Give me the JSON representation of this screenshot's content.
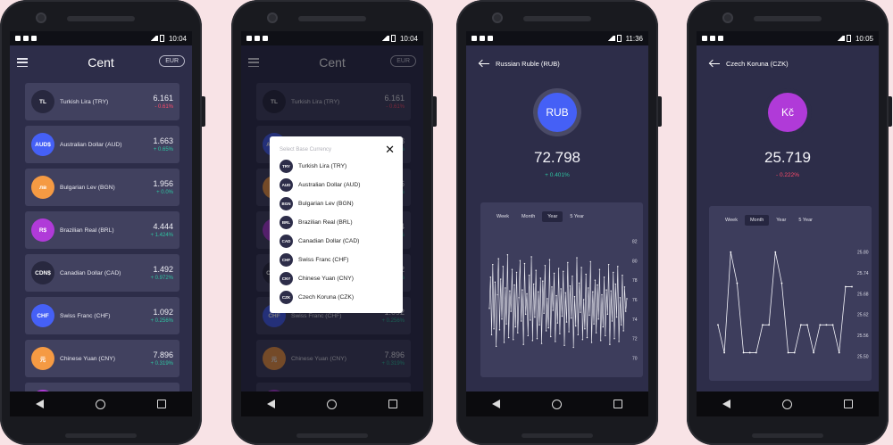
{
  "statusbar_times": [
    "10:04",
    "10:04",
    "11:36",
    "10:05"
  ],
  "list_screen": {
    "title": "Cent",
    "base_currency": "EUR",
    "rows": [
      {
        "code": "TL",
        "name": "Turkish Lira (TRY)",
        "value": "6.161",
        "change": "- 0.61%",
        "dir": "down",
        "color": "#28283f"
      },
      {
        "code": "AUD$",
        "name": "Australian Dollar (AUD)",
        "value": "1.663",
        "change": "+ 0.65%",
        "dir": "up",
        "color": "#4560f6"
      },
      {
        "code": "лв",
        "name": "Bulgarian Lev (BGN)",
        "value": "1.956",
        "change": "+ 0.0%",
        "dir": "up",
        "color": "#f59a43"
      },
      {
        "code": "R$",
        "name": "Brazilian Real (BRL)",
        "value": "4.444",
        "change": "+ 1.424%",
        "dir": "up",
        "color": "#b03ad8"
      },
      {
        "code": "CDN$",
        "name": "Canadian Dollar (CAD)",
        "value": "1.492",
        "change": "+ 0.972%",
        "dir": "up",
        "color": "#28283f"
      },
      {
        "code": "CHF",
        "name": "Swiss Franc (CHF)",
        "value": "1.092",
        "change": "+ 0.256%",
        "dir": "up",
        "color": "#4560f6"
      },
      {
        "code": "元",
        "name": "Chinese Yuan (CNY)",
        "value": "7.896",
        "change": "+ 0.319%",
        "dir": "up",
        "color": "#f59a43"
      }
    ]
  },
  "dialog": {
    "title": "Select Base Currency",
    "close_glyph": "✕",
    "options": [
      {
        "code": "TRY",
        "name": "Turkish Lira (TRY)"
      },
      {
        "code": "AUD",
        "name": "Australian Dollar (AUD)"
      },
      {
        "code": "BGN",
        "name": "Bulgarian Lev (BGN)"
      },
      {
        "code": "BRL",
        "name": "Brazilian Real (BRL)"
      },
      {
        "code": "CAD",
        "name": "Canadian Dollar (CAD)"
      },
      {
        "code": "CHF",
        "name": "Swiss Franc (CHF)"
      },
      {
        "code": "CNY",
        "name": "Chinese Yuan (CNY)"
      },
      {
        "code": "CZK",
        "name": "Czech Koruna (CZK)"
      }
    ]
  },
  "rub_screen": {
    "title": "Russian Ruble (RUB)",
    "badge": "RUB",
    "badge_color": "#4560f6",
    "value": "72.798",
    "change": "+ 0.401%",
    "tabs": [
      "Week",
      "Month",
      "Year",
      "5 Year"
    ],
    "active_tab": "Year"
  },
  "czk_screen": {
    "title": "Czech Koruna (CZK)",
    "badge": "Kč",
    "badge_color": "#b03ad8",
    "value": "25.719",
    "change": "- 0.222%",
    "tabs": [
      "Week",
      "Month",
      "Year",
      "5 Year"
    ],
    "active_tab": "Month"
  },
  "chart_data": [
    {
      "type": "line",
      "title": "",
      "yticks": [
        "82",
        "80",
        "78",
        "76",
        "74",
        "72",
        "70"
      ],
      "ylim": [
        69.5,
        82.5
      ],
      "grid": false,
      "series": [
        {
          "values": [
            75.1,
            78.3,
            72.4,
            79.6,
            73.0,
            77.8,
            71.2,
            76.5,
            80.2,
            72.9,
            78.1,
            74.0,
            79.4,
            71.6,
            77.2,
            73.5,
            80.6,
            72.1,
            76.9,
            74.8,
            79.1,
            71.9,
            77.5,
            73.2,
            78.8,
            72.6,
            76.2,
            80.0,
            73.8,
            77.0,
            71.4,
            79.7,
            74.5,
            76.6,
            72.3,
            78.5,
            73.9,
            80.4,
            71.8,
            77.6,
            74.2,
            79.0,
            72.0,
            76.8,
            73.4,
            78.2,
            71.5,
            77.9,
            74.6,
            79.5,
            72.8,
            76.1,
            73.1,
            80.1,
            72.2,
            77.3,
            74.9,
            78.7,
            71.7,
            76.4,
            73.6,
            79.2,
            72.5,
            77.1,
            74.3,
            78.9,
            71.3,
            76.7,
            73.7,
            79.8,
            72.7,
            77.4,
            74.1,
            78.4,
            71.1,
            76.3,
            73.3,
            80.3,
            72.4,
            77.7,
            74.7,
            79.3,
            71.9,
            76.0,
            73.0,
            78.6,
            72.1,
            77.2,
            74.4,
            79.9,
            71.6,
            76.8,
            73.5,
            78.0,
            72.6,
            77.5,
            74.0,
            79.1,
            71.8,
            76.5,
            73.2,
            78.3,
            72.3,
            77.0,
            74.5,
            79.6,
            71.4,
            76.9,
            73.8,
            78.8,
            72.0,
            77.6,
            74.2,
            79.4,
            71.7,
            76.2,
            73.4,
            78.5,
            72.8,
            77.3,
            74.8,
            76.1
          ]
        }
      ]
    },
    {
      "type": "line",
      "title": "",
      "yticks": [
        "25.80",
        "25.74",
        "25.68",
        "25.62",
        "25.56",
        "25.50"
      ],
      "ylim": [
        25.47,
        25.83
      ],
      "grid": false,
      "series": [
        {
          "values": [
            25.59,
            25.51,
            25.8,
            25.71,
            25.51,
            25.51,
            25.51,
            25.59,
            25.59,
            25.8,
            25.71,
            25.51,
            25.51,
            25.59,
            25.59,
            25.51,
            25.59,
            25.59,
            25.59,
            25.51,
            25.7,
            25.7
          ]
        }
      ]
    }
  ]
}
